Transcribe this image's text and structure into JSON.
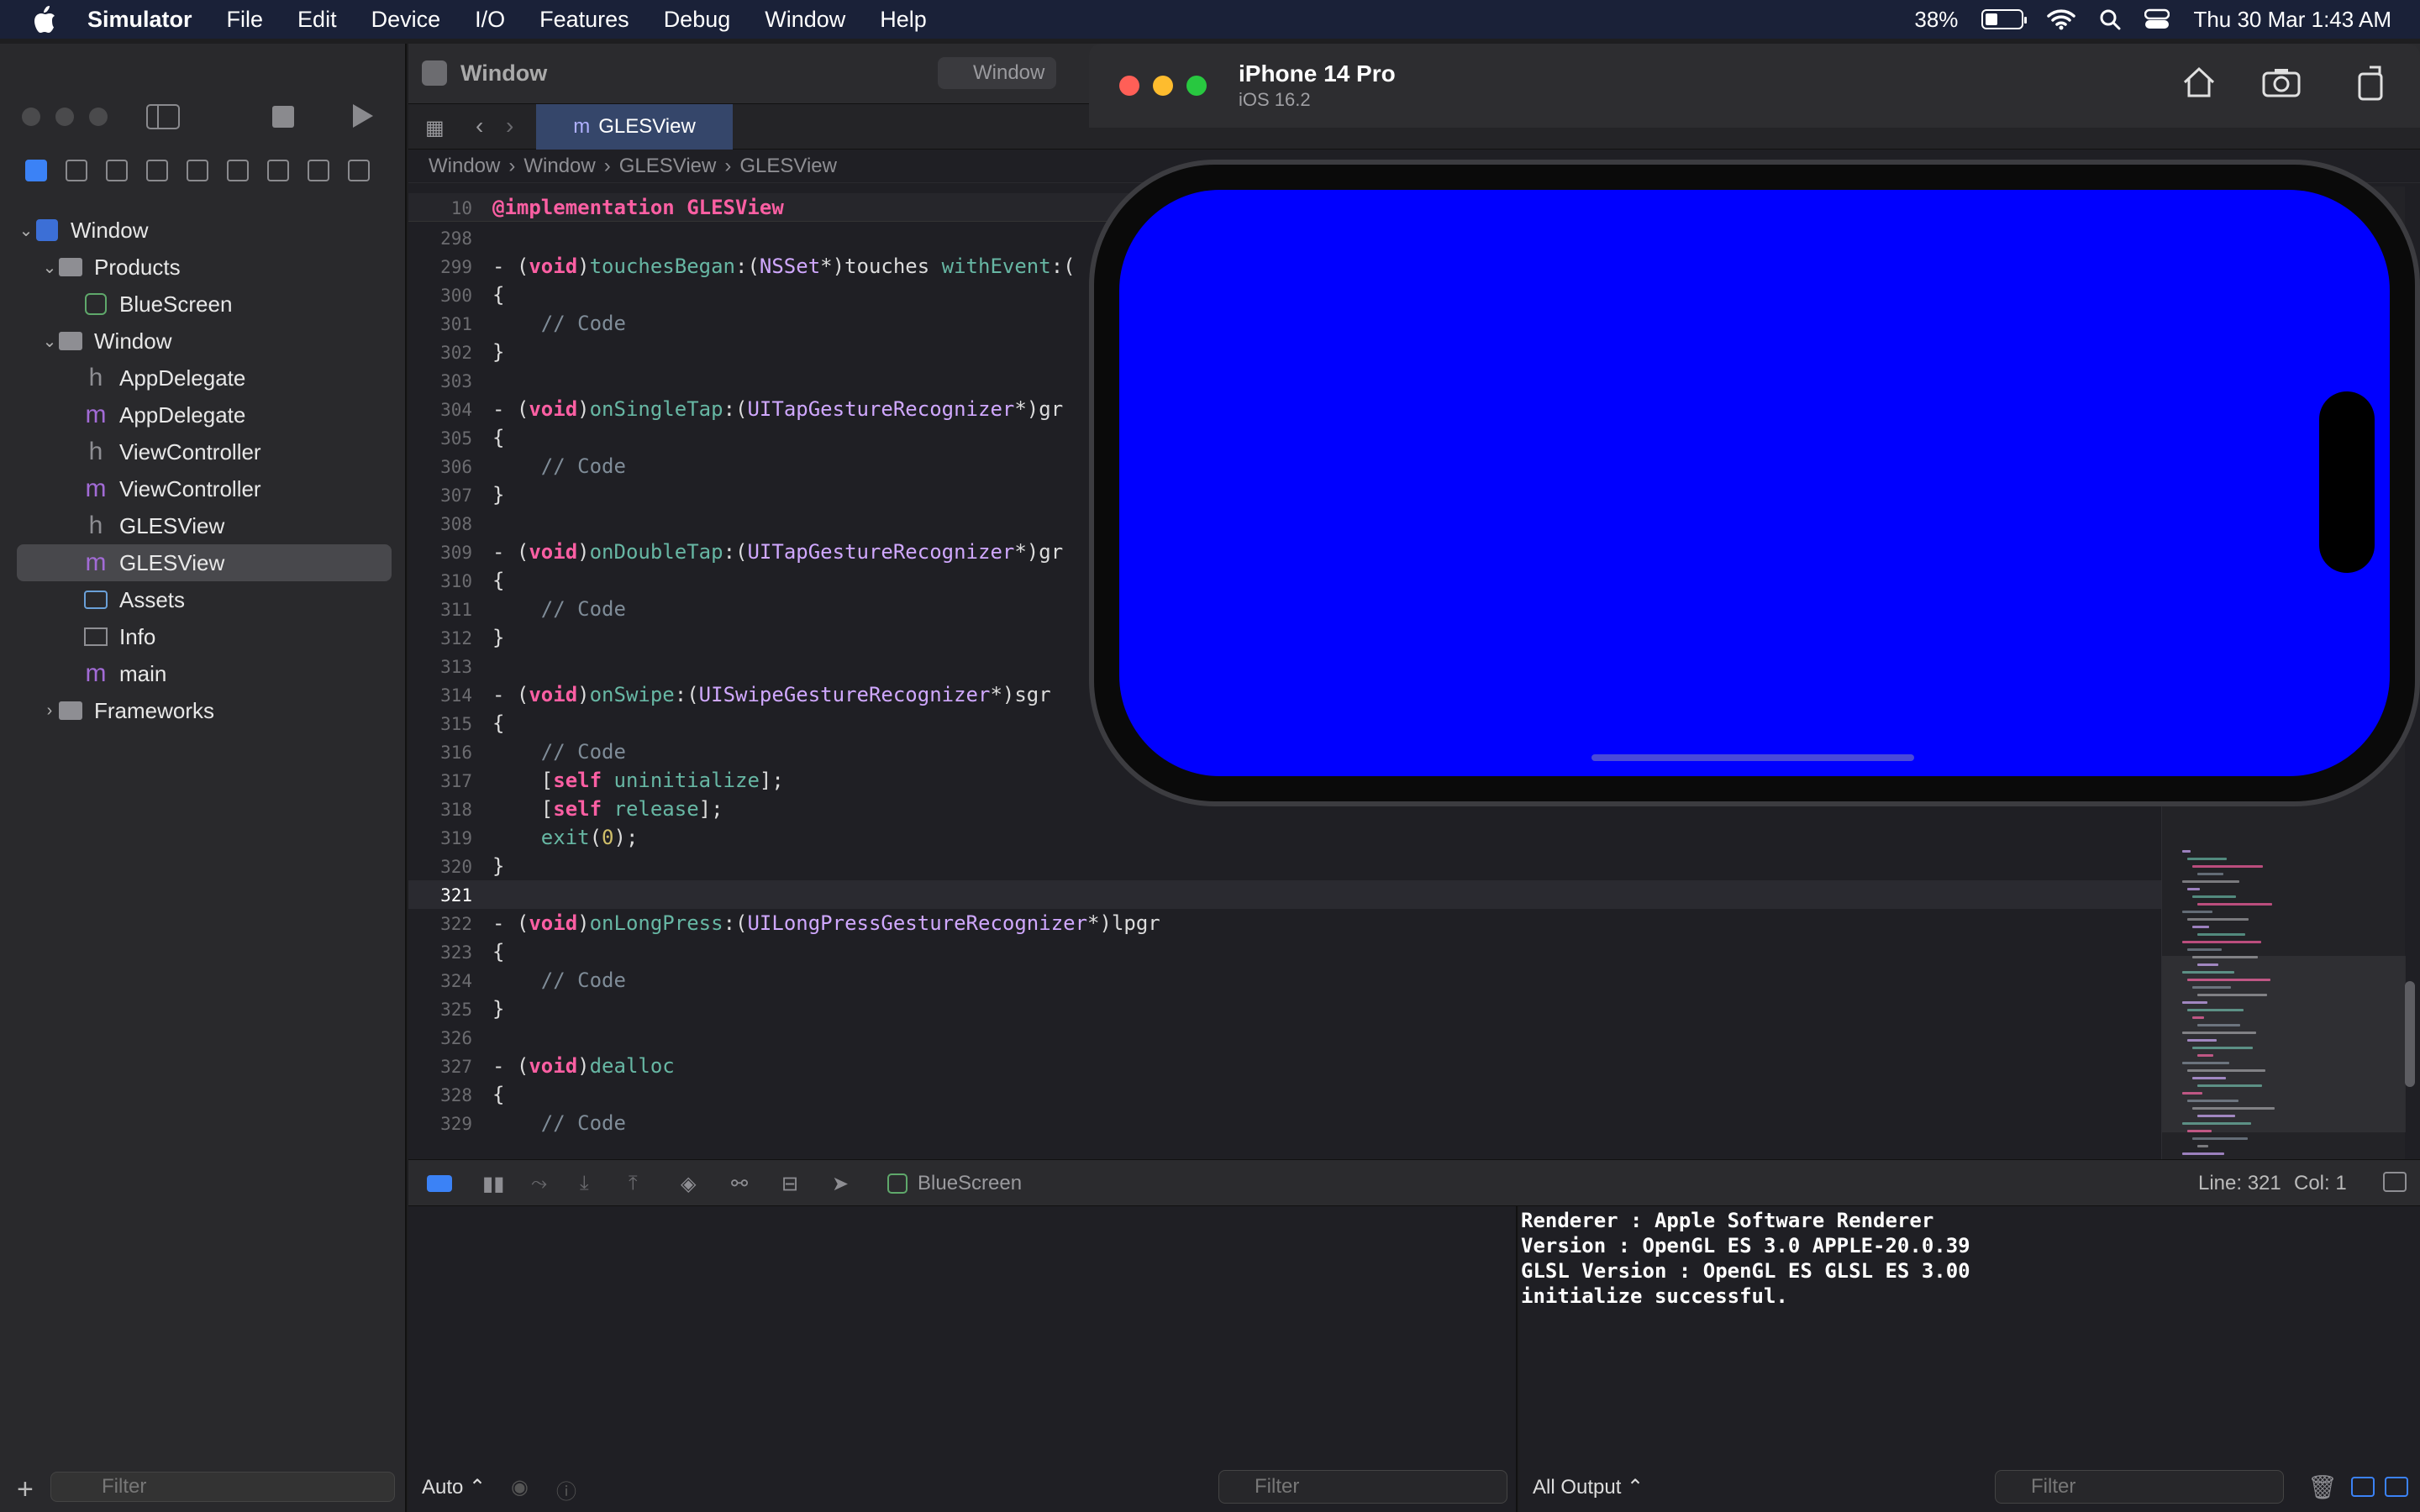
{
  "menubar": {
    "app": "Simulator",
    "items": [
      "File",
      "Edit",
      "Device",
      "I/O",
      "Features",
      "Debug",
      "Window",
      "Help"
    ],
    "battery": "38%",
    "datetime": "Thu 30 Mar  1:43 AM"
  },
  "xcode": {
    "scheme_title": "Window",
    "scheme_crumb": "Window",
    "tab": "GLESView",
    "jumpbar": [
      "Window",
      "Window",
      "GLESView",
      "GLESView"
    ],
    "tree": [
      {
        "label": "Window",
        "icon": "project-icon"
      },
      {
        "label": "Products",
        "icon": "folder-icon"
      },
      {
        "label": "BlueScreen",
        "icon": "app-icon"
      },
      {
        "label": "Window",
        "icon": "folder-icon"
      },
      {
        "label": "AppDelegate",
        "icon": "h"
      },
      {
        "label": "AppDelegate",
        "icon": "m"
      },
      {
        "label": "ViewController",
        "icon": "h"
      },
      {
        "label": "ViewController",
        "icon": "m"
      },
      {
        "label": "GLESView",
        "icon": "h"
      },
      {
        "label": "GLESView",
        "icon": "m"
      },
      {
        "label": "Assets",
        "icon": "assets-icon"
      },
      {
        "label": "Info",
        "icon": "table-icon"
      },
      {
        "label": "main",
        "icon": "m"
      },
      {
        "label": "Frameworks",
        "icon": "folder-icon"
      }
    ],
    "nav_filter_placeholder": "Filter",
    "sticky_line": {
      "num": "10",
      "text": "@implementation GLESView"
    },
    "status": {
      "line": "Line: 321",
      "col": "Col: 1"
    },
    "debug_target": "BlueScreen",
    "auto_label": "Auto ⌃",
    "debug_filter_placeholder": "Filter",
    "output_label": "All Output ⌃",
    "console_filter_placeholder": "Filter",
    "console": "Renderer : Apple Software Renderer\nVersion : OpenGL ES 3.0 APPLE-20.0.39\nGLSL Version : OpenGL ES GLSL ES 3.00\ninitialize successful."
  },
  "code_lines": [
    {
      "n": "298",
      "t": ""
    },
    {
      "n": "299",
      "t": "- (void)touchesBegan:(NSSet*)touches withEvent:("
    },
    {
      "n": "300",
      "t": "{"
    },
    {
      "n": "301",
      "t": "    // Code"
    },
    {
      "n": "302",
      "t": "}"
    },
    {
      "n": "303",
      "t": ""
    },
    {
      "n": "304",
      "t": "- (void)onSingleTap:(UITapGestureRecognizer*)gr"
    },
    {
      "n": "305",
      "t": "{"
    },
    {
      "n": "306",
      "t": "    // Code"
    },
    {
      "n": "307",
      "t": "}"
    },
    {
      "n": "308",
      "t": ""
    },
    {
      "n": "309",
      "t": "- (void)onDoubleTap:(UITapGestureRecognizer*)gr"
    },
    {
      "n": "310",
      "t": "{"
    },
    {
      "n": "311",
      "t": "    // Code"
    },
    {
      "n": "312",
      "t": "}"
    },
    {
      "n": "313",
      "t": ""
    },
    {
      "n": "314",
      "t": "- (void)onSwipe:(UISwipeGestureRecognizer*)sgr"
    },
    {
      "n": "315",
      "t": "{"
    },
    {
      "n": "316",
      "t": "    // Code"
    },
    {
      "n": "317",
      "t": "    [self uninitialize];"
    },
    {
      "n": "318",
      "t": "    [self release];"
    },
    {
      "n": "319",
      "t": "    exit(0);"
    },
    {
      "n": "320",
      "t": "}"
    },
    {
      "n": "321",
      "t": ""
    },
    {
      "n": "322",
      "t": "- (void)onLongPress:(UILongPressGestureRecognizer*)lpgr"
    },
    {
      "n": "323",
      "t": "{"
    },
    {
      "n": "324",
      "t": "    // Code"
    },
    {
      "n": "325",
      "t": "}"
    },
    {
      "n": "326",
      "t": ""
    },
    {
      "n": "327",
      "t": "- (void)dealloc"
    },
    {
      "n": "328",
      "t": "{"
    },
    {
      "n": "329",
      "t": "    // Code"
    }
  ],
  "current_line": "321",
  "simulator": {
    "device": "iPhone 14 Pro",
    "os": "iOS 16.2",
    "screen_color": "#0000ff"
  }
}
